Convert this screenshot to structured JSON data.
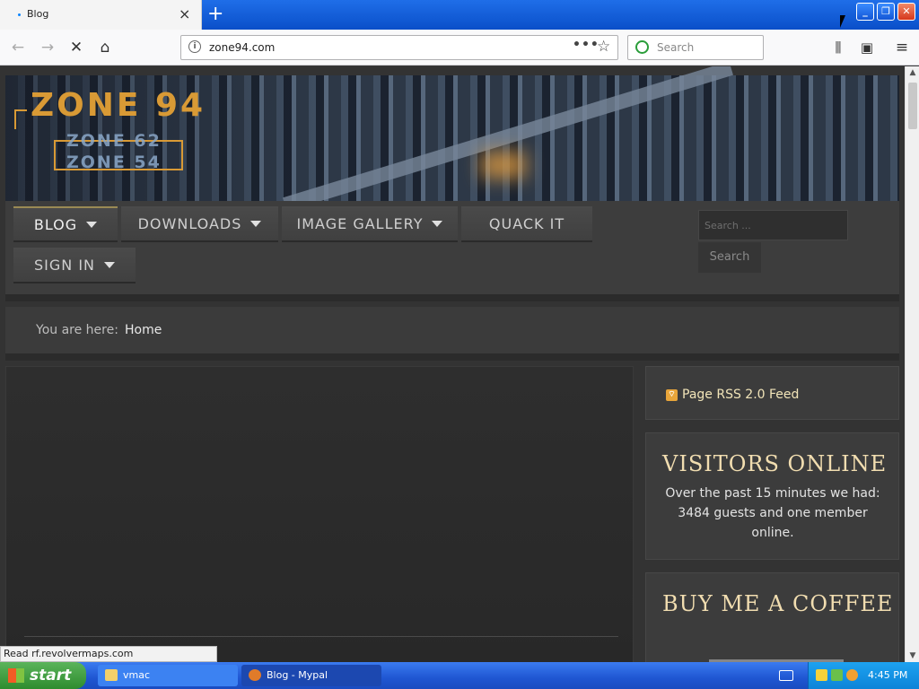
{
  "browser": {
    "tab_title": "Blog",
    "url": "zone94.com",
    "search_placeholder": "Search",
    "status_tip": "Read rf.revolvermaps.com"
  },
  "site": {
    "logo_main": "ZONE 94",
    "logo_sub1": "ZONE 62",
    "logo_sub2": "ZONE 54",
    "menu": [
      {
        "label": "BLOG",
        "has_dropdown": true
      },
      {
        "label": "DOWNLOADS",
        "has_dropdown": true
      },
      {
        "label": "IMAGE GALLERY",
        "has_dropdown": true
      },
      {
        "label": "QUACK IT",
        "has_dropdown": false
      },
      {
        "label": "SIGN IN",
        "has_dropdown": true
      }
    ],
    "search_placeholder": "Search ...",
    "search_button": "Search",
    "breadcrumb": {
      "label": "You are here:",
      "current": "Home"
    }
  },
  "sidebar": {
    "rss_link": "Page RSS 2.0 Feed",
    "visitors": {
      "title": "VISITORS ONLINE",
      "text": "Over the past 15 minutes we had: 3484 guests and one member online."
    },
    "coffee": {
      "title": "BUY ME A COFFEE"
    }
  },
  "taskbar": {
    "start_label": "start",
    "tasks": [
      {
        "label": "vmac"
      },
      {
        "label": "Blog - Mypal"
      }
    ],
    "clock": "4:45 PM"
  },
  "colors": {
    "page_bg": "#333333",
    "heading_gold": "#f1ddb0",
    "logo_orange": "#d99a35"
  }
}
